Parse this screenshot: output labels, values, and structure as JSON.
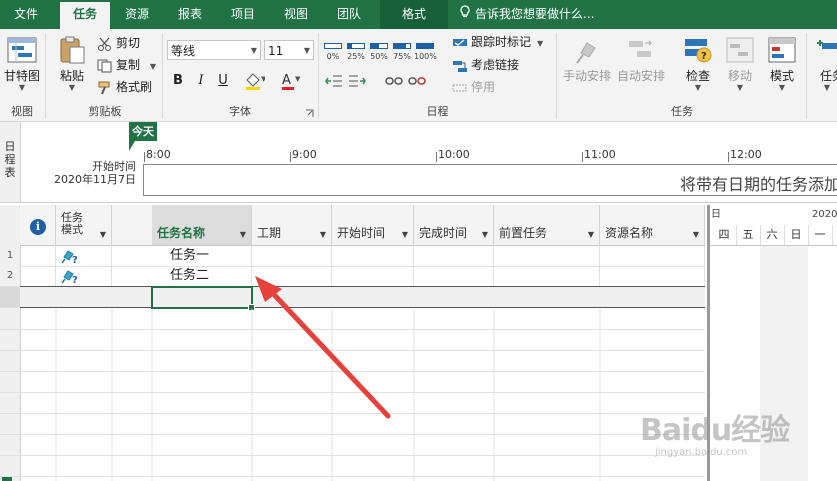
{
  "tabs": [
    "文件",
    "任务",
    "资源",
    "报表",
    "项目",
    "视图",
    "团队",
    "格式"
  ],
  "tell_me": "告诉我您想要做什么...",
  "ribbon": {
    "view": {
      "gantt": "甘特图",
      "label": "视图"
    },
    "clipboard": {
      "paste": "粘贴",
      "cut": "剪切",
      "copy": "复制",
      "format_painter": "格式刷",
      "label": "剪贴板"
    },
    "font": {
      "family": "等线",
      "size": "11",
      "bold": "B",
      "italic": "I",
      "underline": "U",
      "label": "字体"
    },
    "schedule": {
      "pcts": [
        "0%",
        "25%",
        "50%",
        "75%",
        "100%"
      ],
      "mark_on_track": "跟踪时标记",
      "respect_links": "考虑链接",
      "inactivate": "停用",
      "label": "日程"
    },
    "tasks": {
      "manual": "手动安排",
      "auto": "自动安排",
      "inspect": "检查",
      "move": "移动",
      "mode": "模式",
      "task": "任务",
      "label": "任务"
    }
  },
  "timeline": {
    "side_label": "日程表",
    "today": "今天",
    "start_label": "开始时间",
    "start_date": "2020年11月7日",
    "ticks": [
      "8:00",
      "9:00",
      "10:00",
      "11:00",
      "12:00"
    ],
    "placeholder": "将带有日期的任务添加"
  },
  "grid": {
    "columns": {
      "task_mode": "任务\n模式",
      "task_name": "任务名称",
      "duration": "工期",
      "start": "开始时间",
      "finish": "完成时间",
      "predecessors": "前置任务",
      "resources": "资源名称"
    },
    "rows": [
      {
        "id": "1",
        "name": "任务一"
      },
      {
        "id": "2",
        "name": "任务二"
      }
    ]
  },
  "gantt": {
    "week_label_1": "日",
    "week_label_2": "2020",
    "days": [
      "四",
      "五",
      "六",
      "日",
      "一"
    ]
  },
  "watermark": {
    "brand": "Baidu经验",
    "url": "jingyan.baidu.com"
  },
  "colors": {
    "accent": "#217346",
    "arrow": "#e8403a"
  }
}
